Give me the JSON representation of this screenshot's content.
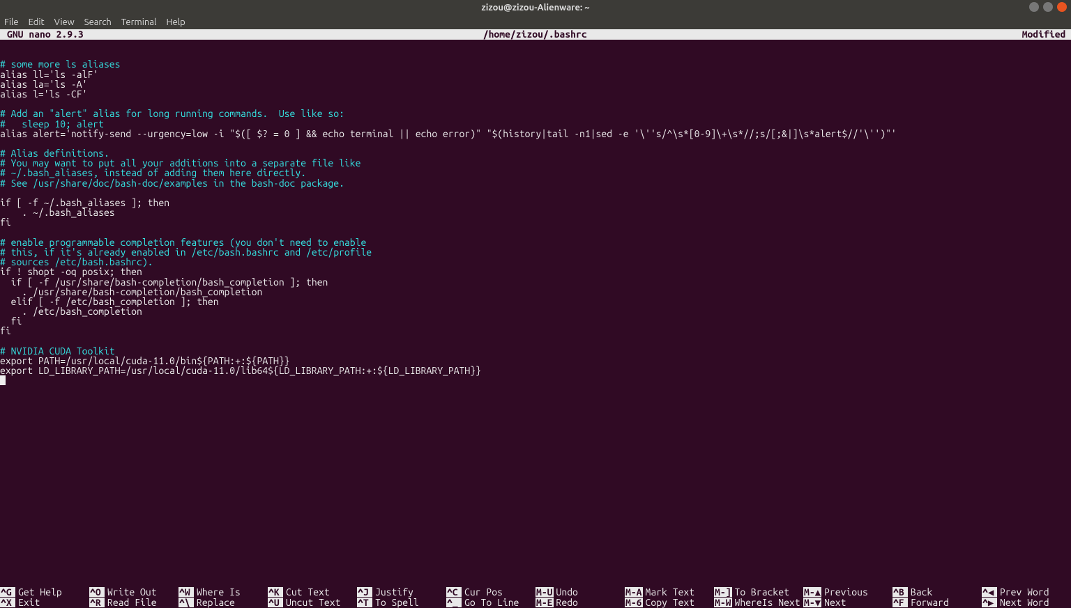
{
  "window": {
    "title": "zizou@zizou-Alienware: ~"
  },
  "menubar": [
    "File",
    "Edit",
    "View",
    "Search",
    "Terminal",
    "Help"
  ],
  "header": {
    "app": "  GNU nano 2.9.3",
    "file": "/home/zizou/.bashrc",
    "status": "Modified"
  },
  "lines": [
    {
      "t": "blank",
      "s": ""
    },
    {
      "t": "blank",
      "s": ""
    },
    {
      "t": "comment",
      "s": "# some more ls aliases"
    },
    {
      "t": "plain",
      "s": "alias ll='ls -alF'"
    },
    {
      "t": "plain",
      "s": "alias la='ls -A'"
    },
    {
      "t": "plain",
      "s": "alias l='ls -CF'"
    },
    {
      "t": "blank",
      "s": ""
    },
    {
      "t": "comment",
      "s": "# Add an \"alert\" alias for long running commands.  Use like so:"
    },
    {
      "t": "comment",
      "s": "#   sleep 10; alert"
    },
    {
      "t": "plain",
      "s": "alias alert='notify-send --urgency=low -i \"$([ $? = 0 ] && echo terminal || echo error)\" \"$(history|tail -n1|sed -e '\\''s/^\\s*[0-9]\\+\\s*//;s/[;&|]\\s*alert$//'\\'')\"'"
    },
    {
      "t": "blank",
      "s": ""
    },
    {
      "t": "comment",
      "s": "# Alias definitions."
    },
    {
      "t": "comment",
      "s": "# You may want to put all your additions into a separate file like"
    },
    {
      "t": "comment",
      "s": "# ~/.bash_aliases, instead of adding them here directly."
    },
    {
      "t": "comment",
      "s": "# See /usr/share/doc/bash-doc/examples in the bash-doc package."
    },
    {
      "t": "blank",
      "s": ""
    },
    {
      "t": "plain",
      "s": "if [ -f ~/.bash_aliases ]; then"
    },
    {
      "t": "plain",
      "s": "    . ~/.bash_aliases"
    },
    {
      "t": "plain",
      "s": "fi"
    },
    {
      "t": "blank",
      "s": ""
    },
    {
      "t": "comment",
      "s": "# enable programmable completion features (you don't need to enable"
    },
    {
      "t": "comment",
      "s": "# this, if it's already enabled in /etc/bash.bashrc and /etc/profile"
    },
    {
      "t": "comment",
      "s": "# sources /etc/bash.bashrc)."
    },
    {
      "t": "plain",
      "s": "if ! shopt -oq posix; then"
    },
    {
      "t": "plain",
      "s": "  if [ -f /usr/share/bash-completion/bash_completion ]; then"
    },
    {
      "t": "plain",
      "s": "    . /usr/share/bash-completion/bash_completion"
    },
    {
      "t": "plain",
      "s": "  elif [ -f /etc/bash_completion ]; then"
    },
    {
      "t": "plain",
      "s": "    . /etc/bash_completion"
    },
    {
      "t": "plain",
      "s": "  fi"
    },
    {
      "t": "plain",
      "s": "fi"
    },
    {
      "t": "blank",
      "s": ""
    },
    {
      "t": "comment",
      "s": "# NVIDIA CUDA Toolkit"
    },
    {
      "t": "plain",
      "s": "export PATH=/usr/local/cuda-11.0/bin${PATH:+:${PATH}}"
    },
    {
      "t": "plain",
      "s": "export LD_LIBRARY_PATH=/usr/local/cuda-11.0/lib64${LD_LIBRARY_PATH:+:${LD_LIBRARY_PATH}}"
    }
  ],
  "help_row1": [
    {
      "k": "^G",
      "l": "Get Help"
    },
    {
      "k": "^O",
      "l": "Write Out"
    },
    {
      "k": "^W",
      "l": "Where Is"
    },
    {
      "k": "^K",
      "l": "Cut Text"
    },
    {
      "k": "^J",
      "l": "Justify"
    },
    {
      "k": "^C",
      "l": "Cur Pos"
    },
    {
      "k": "M-U",
      "l": "Undo"
    },
    {
      "k": "M-A",
      "l": "Mark Text"
    },
    {
      "k": "M-]",
      "l": "To Bracket"
    },
    {
      "k": "M-▲",
      "l": "Previous"
    },
    {
      "k": "^B",
      "l": "Back"
    },
    {
      "k": "^◀",
      "l": "Prev Word"
    }
  ],
  "help_row2": [
    {
      "k": "^X",
      "l": "Exit"
    },
    {
      "k": "^R",
      "l": "Read File"
    },
    {
      "k": "^\\",
      "l": "Replace"
    },
    {
      "k": "^U",
      "l": "Uncut Text"
    },
    {
      "k": "^T",
      "l": "To Spell"
    },
    {
      "k": "^_",
      "l": "Go To Line"
    },
    {
      "k": "M-E",
      "l": "Redo"
    },
    {
      "k": "M-6",
      "l": "Copy Text"
    },
    {
      "k": "M-W",
      "l": "WhereIs Next"
    },
    {
      "k": "M-▼",
      "l": "Next"
    },
    {
      "k": "^F",
      "l": "Forward"
    },
    {
      "k": "^▶",
      "l": "Next Word"
    }
  ]
}
